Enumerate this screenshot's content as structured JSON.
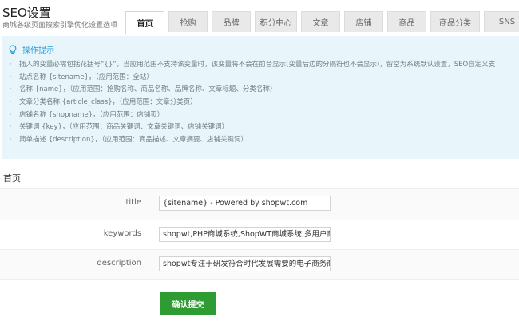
{
  "header": {
    "title": "SEO设置",
    "subtitle": "商城各级页面搜索引擎优化设置选项"
  },
  "tabs": [
    {
      "label": "首页",
      "active": true
    },
    {
      "label": "抢购",
      "active": false
    },
    {
      "label": "品牌",
      "active": false
    },
    {
      "label": "积分中心",
      "active": false
    },
    {
      "label": "文章",
      "active": false
    },
    {
      "label": "店铺",
      "active": false
    },
    {
      "label": "商品",
      "active": false
    },
    {
      "label": "商品分类",
      "active": false
    },
    {
      "label": "SNS",
      "active": false
    }
  ],
  "tips": {
    "heading": "操作提示",
    "items": [
      "插入的变量必需包括花括号“{}”，当应用范围不支持该变量时，该变量将不会在前台显示(变量后边的分隔符也不会显示)，留空为系统默认设置，SEO自定义支",
      "站点名称 {sitename}，（应用范围：全站）",
      "名称 {name}，（应用范围：抢购名称、商品名称、品牌名称、文章标题、分类名称）",
      "文章分类名称 {article_class}，（应用范围：文章分类页）",
      "店铺名称 {shopname}，（应用范围：店铺页）",
      "关键词 {key}，（应用范围：商品关键词、文章关键词、店铺关键词）",
      "简单描述 {description}，（应用范围：商品描述、文章摘要、店铺关键词）"
    ]
  },
  "section": {
    "title": "首页"
  },
  "form": {
    "title_label": "title",
    "title_value": "{sitename} - Powered by shopwt.com",
    "keywords_label": "keywords",
    "keywords_value": "shopwt,PHP商城系统,ShopWT商城系统,多用户商城",
    "description_label": "description",
    "description_value": "shopwt专注于研发符合时代发展需要的电子商务商城"
  },
  "submit_label": "确认提交",
  "colors": {
    "tip_bg": "#e8f6fb",
    "tip_heading": "#2a9bd1",
    "submit_bg": "#2e9b33"
  },
  "icons": {
    "tips": "lightbulb-icon"
  }
}
